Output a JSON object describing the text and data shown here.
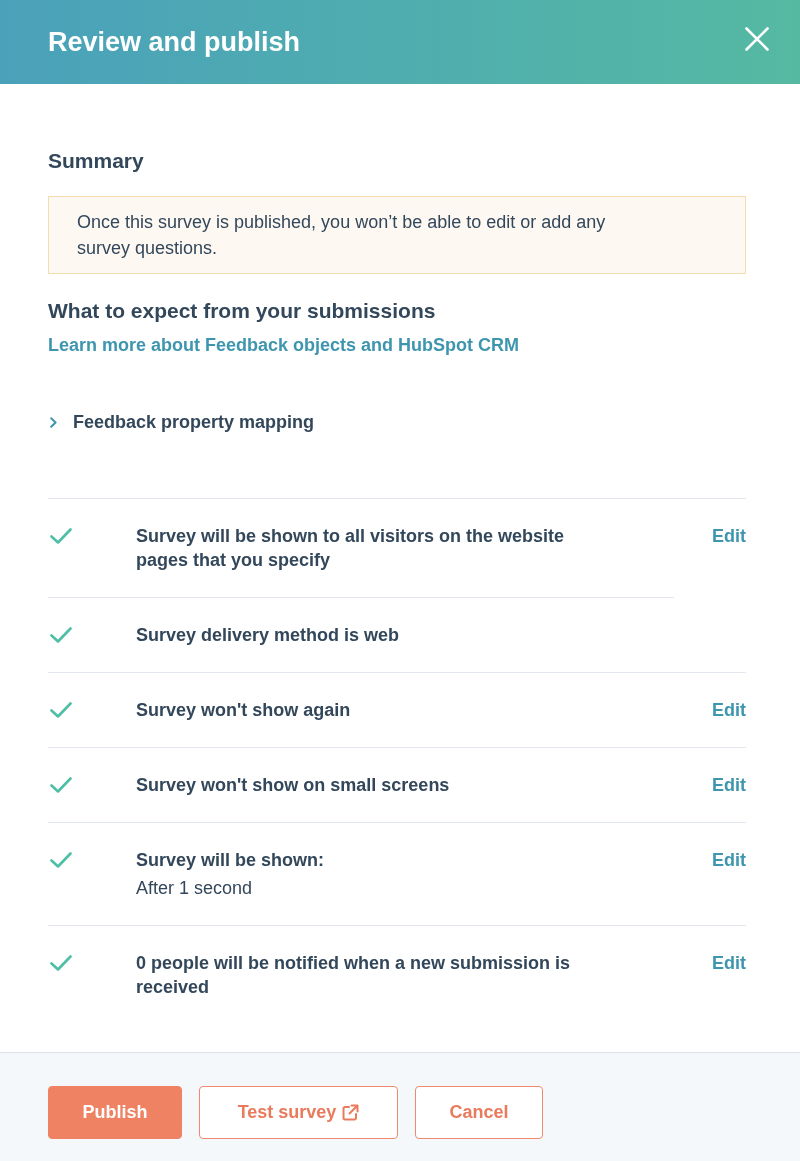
{
  "dialog": {
    "title": "Review and publish"
  },
  "summary": {
    "heading": "Summary",
    "notice": "Once this survey is published, you won’t be able to edit or add any survey questions."
  },
  "submissions": {
    "heading": "What to expect from your submissions",
    "link": "Learn more about Feedback objects and HubSpot CRM"
  },
  "collapsible": {
    "label": "Feedback property mapping",
    "expanded": false
  },
  "checklist": [
    {
      "text": "Survey will be shown to all visitors on the website pages that you specify",
      "checked": true,
      "edit": "Edit"
    },
    {
      "text": "Survey delivery method is web",
      "checked": true
    },
    {
      "text": "Survey won't show again",
      "checked": true,
      "edit": "Edit"
    },
    {
      "text": "Survey won't show on small screens",
      "checked": true,
      "edit": "Edit"
    },
    {
      "text": "Survey will be shown:",
      "detail": "After 1 second",
      "checked": true,
      "edit": "Edit"
    },
    {
      "text": "0 people will be notified when a new submission is received",
      "checked": true,
      "edit": "Edit"
    }
  ],
  "buttons": [
    {
      "label": "Publish",
      "kind": "primary",
      "external": false
    },
    {
      "label": "Test survey",
      "kind": "secondary",
      "external": true
    },
    {
      "label": "Cancel",
      "kind": "secondary",
      "external": false
    }
  ]
}
